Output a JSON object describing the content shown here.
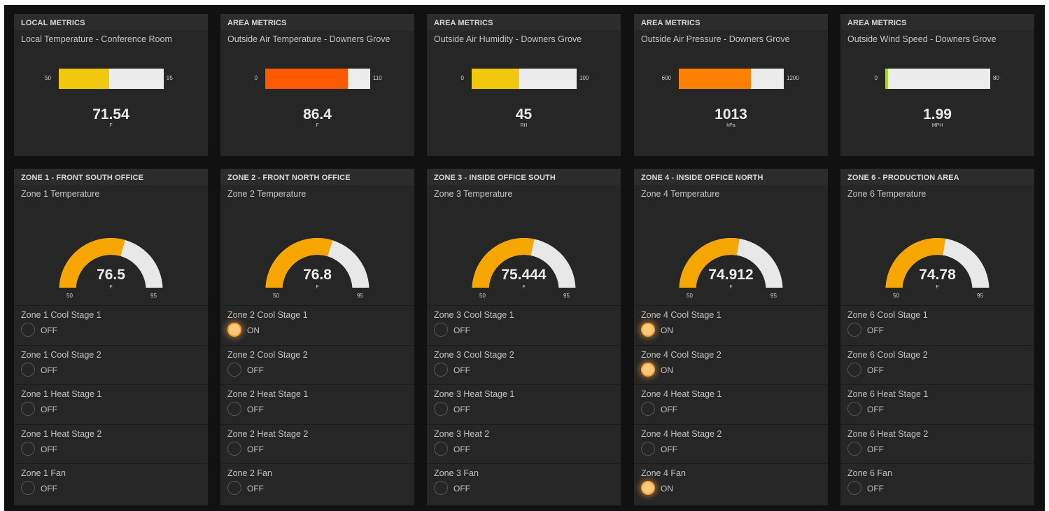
{
  "metric_cards": [
    {
      "header": "LOCAL METRICS",
      "title": "Local Temperature - Conference Room",
      "min": "50",
      "max": "95",
      "value": "71.54",
      "unit": "F",
      "fraction": 0.4787,
      "color": "#f2c80f"
    },
    {
      "header": "AREA METRICS",
      "title": "Outside Air Temperature - Downers Grove",
      "min": "0",
      "max": "110",
      "value": "86.4",
      "unit": "F",
      "fraction": 0.7855,
      "color": "#ff5a00"
    },
    {
      "header": "AREA METRICS",
      "title": "Outside Air Humidity - Downers Grove",
      "min": "0",
      "max": "100",
      "value": "45",
      "unit": "RH",
      "fraction": 0.45,
      "color": "#f2c80f"
    },
    {
      "header": "AREA METRICS",
      "title": "Outside Air Pressure - Downers Grove",
      "min": "600",
      "max": "1200",
      "value": "1013",
      "unit": "hPa",
      "fraction": 0.6883,
      "color": "#ff7f00"
    },
    {
      "header": "AREA METRICS",
      "title": "Outside Wind Speed - Downers Grove",
      "min": "0",
      "max": "80",
      "value": "1.99",
      "unit": "MPH",
      "fraction": 0.0249,
      "color": "#a8d818"
    }
  ],
  "zones": [
    {
      "header": "ZONE 1 - FRONT SOUTH OFFICE",
      "title": "Zone 1 Temperature",
      "value": "76.5",
      "unit": "F",
      "min": "50",
      "max": "95",
      "fraction": 0.5889,
      "switches": [
        {
          "label": "Zone 1 Cool Stage 1",
          "state": "OFF",
          "on": false
        },
        {
          "label": "Zone 1 Cool Stage 2",
          "state": "OFF",
          "on": false
        },
        {
          "label": "Zone 1 Heat Stage 1",
          "state": "OFF",
          "on": false
        },
        {
          "label": "Zone 1 Heat Stage 2",
          "state": "OFF",
          "on": false
        },
        {
          "label": "Zone 1 Fan",
          "state": "OFF",
          "on": false
        }
      ]
    },
    {
      "header": "ZONE 2 - FRONT NORTH OFFICE",
      "title": "Zone 2 Temperature",
      "value": "76.8",
      "unit": "F",
      "min": "50",
      "max": "95",
      "fraction": 0.5956,
      "switches": [
        {
          "label": "Zone 2 Cool Stage 1",
          "state": "ON",
          "on": true
        },
        {
          "label": "Zone 2 Cool Stage 2",
          "state": "OFF",
          "on": false
        },
        {
          "label": "Zone 2 Heat Stage 1",
          "state": "OFF",
          "on": false
        },
        {
          "label": "Zone 2 Heat Stage 2",
          "state": "OFF",
          "on": false
        },
        {
          "label": "Zone 2 Fan",
          "state": "OFF",
          "on": false
        }
      ]
    },
    {
      "header": "ZONE 3 - INSIDE OFFICE SOUTH",
      "title": "Zone 3 Temperature",
      "value": "75.444",
      "unit": "F",
      "min": "50",
      "max": "95",
      "fraction": 0.5654,
      "switches": [
        {
          "label": "Zone 3 Cool Stage 1",
          "state": "OFF",
          "on": false
        },
        {
          "label": "Zone 3 Cool Stage 2",
          "state": "OFF",
          "on": false
        },
        {
          "label": "Zone 3 Heat Stage 1",
          "state": "OFF",
          "on": false
        },
        {
          "label": "Zone 3 Heat 2",
          "state": "OFF",
          "on": false
        },
        {
          "label": "Zone 3 Fan",
          "state": "OFF",
          "on": false
        }
      ]
    },
    {
      "header": "ZONE 4 - INSIDE OFFICE NORTH",
      "title": "Zone 4 Temperature",
      "value": "74.912",
      "unit": "F",
      "min": "50",
      "max": "95",
      "fraction": 0.5536,
      "switches": [
        {
          "label": "Zone 4 Cool Stage 1",
          "state": "ON",
          "on": true
        },
        {
          "label": "Zone 4 Cool Stage 2",
          "state": "ON",
          "on": true
        },
        {
          "label": "Zone 4 Heat Stage 1",
          "state": "OFF",
          "on": false
        },
        {
          "label": "Zone 4 Heat Stage 2",
          "state": "OFF",
          "on": false
        },
        {
          "label": "Zone 4 Fan",
          "state": "ON",
          "on": true
        }
      ]
    },
    {
      "header": "ZONE 6 - PRODUCTION AREA",
      "title": "Zone 6 Temperature",
      "value": "74.78",
      "unit": "F",
      "min": "50",
      "max": "95",
      "fraction": 0.5507,
      "switches": [
        {
          "label": "Zone 6 Cool Stage 1",
          "state": "OFF",
          "on": false
        },
        {
          "label": "Zone 6 Cool Stage 2",
          "state": "OFF",
          "on": false
        },
        {
          "label": "Zone 6 Heat Stage 1",
          "state": "OFF",
          "on": false
        },
        {
          "label": "Zone 6 Heat Stage 2",
          "state": "OFF",
          "on": false
        },
        {
          "label": "Zone 6 Fan",
          "state": "OFF",
          "on": false
        }
      ]
    }
  ],
  "colors": {
    "background": "#111111",
    "card": "#262626",
    "gauge_fill": "#f7a600",
    "gauge_track": "#e8e8e8",
    "led_on": "#ffc97a"
  }
}
